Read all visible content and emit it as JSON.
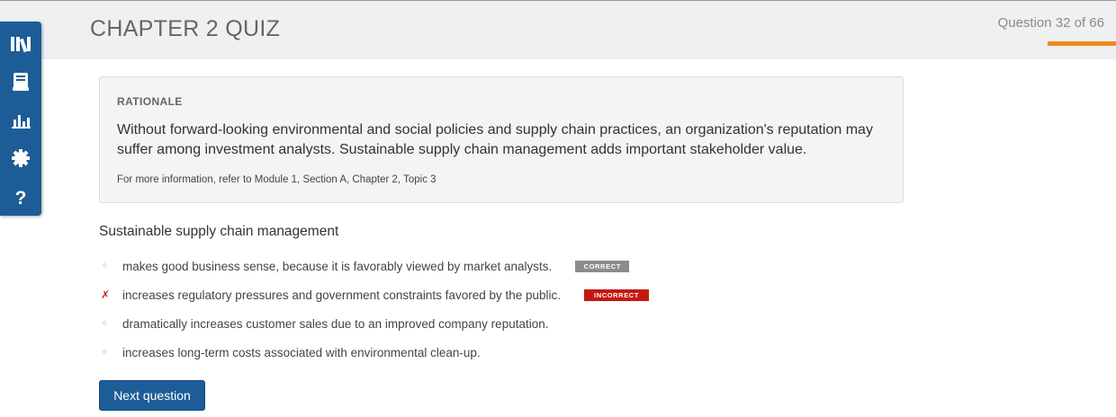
{
  "header": {
    "title": "CHAPTER 2 QUIZ",
    "question_counter": "Question 32 of 66"
  },
  "sidebar": {
    "items": [
      {
        "icon": "library-icon"
      },
      {
        "icon": "flashcards-icon"
      },
      {
        "icon": "chart-icon"
      },
      {
        "icon": "settings-icon"
      },
      {
        "icon": "help-icon"
      }
    ]
  },
  "rationale": {
    "heading": "RATIONALE",
    "body": "Without forward-looking environmental and social policies and supply chain practices, an organization's reputation may suffer among investment analysts. Sustainable supply chain management adds important stakeholder value.",
    "reference": "For more information, refer to Module 1, Section A, Chapter 2, Topic 3"
  },
  "question": {
    "text": "Sustainable supply chain management",
    "answers": [
      {
        "marker": "✧",
        "text": "makes good business sense, because it is favorably viewed by market analysts.",
        "badge": "CORRECT"
      },
      {
        "marker": "✗",
        "text": "increases regulatory pressures and government constraints favored by the public.",
        "badge": "INCORRECT"
      },
      {
        "marker": "✧",
        "text": "dramatically increases customer sales due to an improved company reputation."
      },
      {
        "marker": "✧",
        "text": "increases long-term costs associated with environmental clean-up."
      }
    ]
  },
  "actions": {
    "next_label": "Next question"
  },
  "colors": {
    "brand_blue": "#1d5d97",
    "progress_orange": "#ef8a22",
    "incorrect_red": "#c4180f",
    "correct_gray": "#8c8c8c"
  }
}
